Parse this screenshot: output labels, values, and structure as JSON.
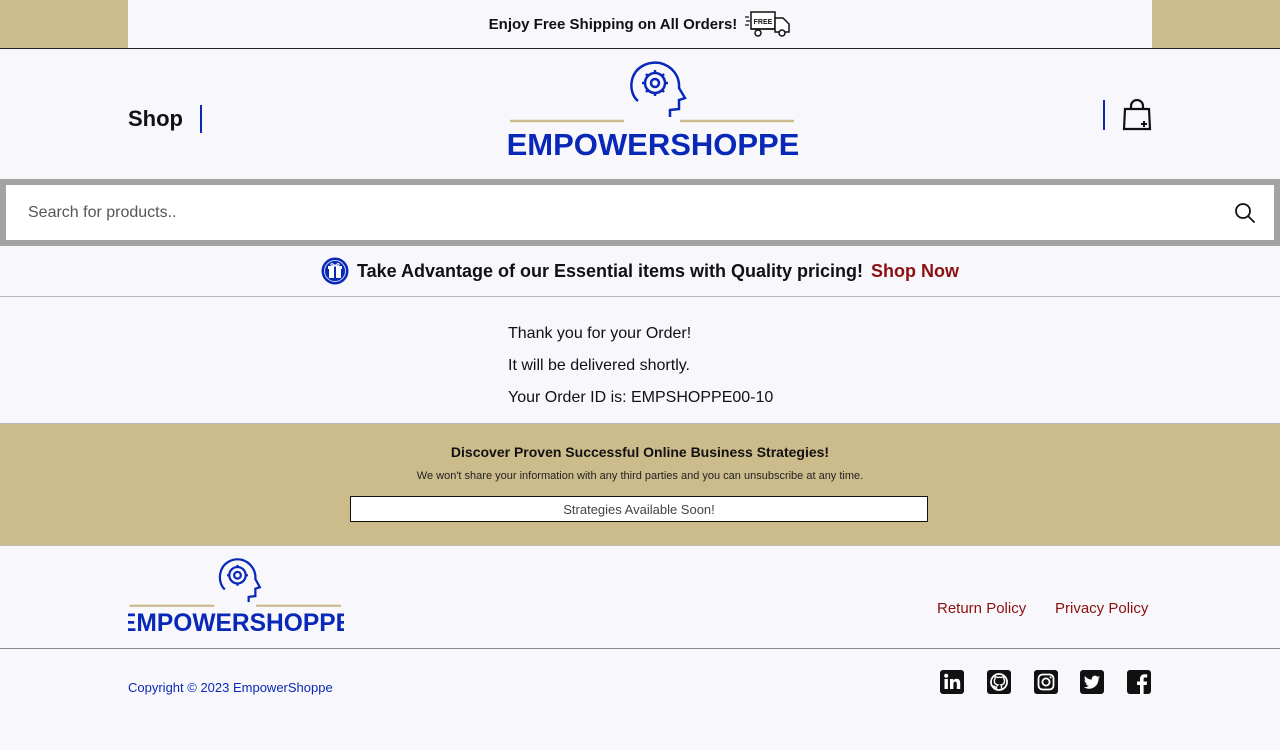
{
  "top_banner": {
    "text": "Enjoy Free Shipping on All Orders!",
    "icon": "free-shipping-truck-icon",
    "badge": "FREE"
  },
  "header": {
    "shop_label": "Shop",
    "logo_text": "EMPOWERSHOPPE",
    "cart_icon": "shopping-bag-icon"
  },
  "search": {
    "placeholder": "Search for products..",
    "value": ""
  },
  "promo": {
    "text": "Take Advantage of our Essential items with Quality pricing!",
    "link": "Shop Now",
    "icon": "gift-icon"
  },
  "order": {
    "line1": "Thank you for your Order!",
    "line2": "It will be delivered shortly.",
    "line3": "Your Order ID is: EMPSHOPPE00-10"
  },
  "newsletter": {
    "title": "Discover Proven Successful Online Business Strategies!",
    "subtitle": "We won't share your information with any third parties and you can unsubscribe at any time.",
    "button": "Strategies Available Soon!"
  },
  "footer": {
    "logo_text": "EMPOWERSHOPPE",
    "return_policy": "Return Policy",
    "privacy_policy": "Privacy Policy",
    "copyright": "Copyright © 2023 EmpowerShoppe",
    "social": [
      "linkedin-icon",
      "github-icon",
      "instagram-icon",
      "twitter-icon",
      "facebook-icon"
    ]
  },
  "colors": {
    "brand_blue": "#0a28b8",
    "gold": "#ccbc8c",
    "link_red": "#8c1010"
  }
}
